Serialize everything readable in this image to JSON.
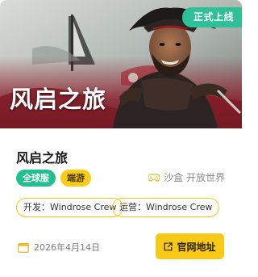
{
  "cover": {
    "status_badge": "正式上线",
    "title": "风启之旅"
  },
  "game": {
    "title": "风启之旅",
    "tags": [
      "全球服",
      "端游"
    ],
    "genre": "沙盒 开放世界",
    "developer": "开发：Windrose Crew",
    "publisher": "运营：Windrose Crew",
    "release_date": "2026年4月14日",
    "website_button": "官网地址"
  },
  "colors": {
    "accent_green": "#22bf92",
    "accent_yellow": "#f8c916",
    "cover_red": "#8c1f2b"
  },
  "icons": [
    "gamepad-icon",
    "calendar-icon",
    "external-link-icon"
  ]
}
